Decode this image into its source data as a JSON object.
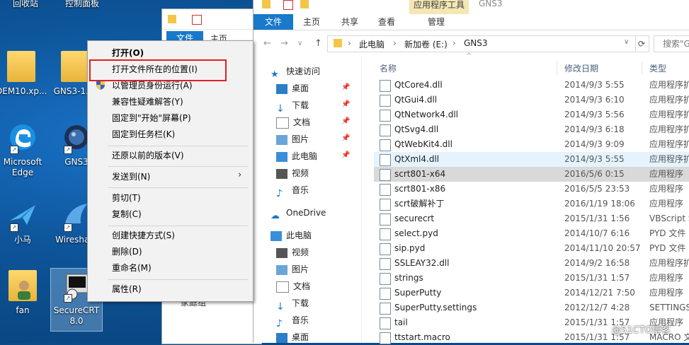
{
  "desktop": {
    "icons": [
      {
        "label": "回收站",
        "icon": "recycle-bin-icon"
      },
      {
        "label": "控制面板",
        "icon": "control-panel-icon"
      },
      {
        "label": "DEM10.xp...",
        "icon": "folder-icon"
      },
      {
        "label": "GNS3-1....",
        "icon": "folder-icon"
      },
      {
        "label": "Microsoft Edge",
        "icon": "edge-icon"
      },
      {
        "label": "GNS3",
        "icon": "gns3-icon"
      },
      {
        "label": "小马",
        "icon": "bird-icon"
      },
      {
        "label": "Wiresha...",
        "icon": "wireshark-icon"
      },
      {
        "label": "fan",
        "icon": "user-folder-icon"
      },
      {
        "label": "SecureCRT 8.0",
        "icon": "securecrt-icon"
      }
    ]
  },
  "back_window": {
    "file_tab": "文件",
    "home_tab": "主页",
    "nav_partial": "家庭组"
  },
  "window": {
    "context_tab_group": "应用程序工具",
    "title": "GNS3",
    "tabs": {
      "file": "文件",
      "home": "主页",
      "share": "共享",
      "view": "查看",
      "manage": "管理"
    },
    "address": {
      "crumbs": [
        "此电脑",
        "新加卷 (E:)",
        "GNS3"
      ]
    },
    "search_placeholder": "搜索\"G",
    "nav": [
      {
        "label": "快速访问",
        "icon": "star-icon",
        "pinned": false
      },
      {
        "label": "桌面",
        "icon": "desktop-icon",
        "pinned": true
      },
      {
        "label": "下载",
        "icon": "download-icon",
        "pinned": true
      },
      {
        "label": "文档",
        "icon": "document-icon",
        "pinned": true
      },
      {
        "label": "图片",
        "icon": "picture-icon",
        "pinned": true
      },
      {
        "label": "此电脑",
        "icon": "pc-icon",
        "pinned": true
      },
      {
        "label": "视频",
        "icon": "video-icon",
        "pinned": false
      },
      {
        "label": "音乐",
        "icon": "music-icon",
        "pinned": false
      },
      {
        "label": "OneDrive",
        "icon": "cloud-icon",
        "pinned": false
      },
      {
        "label": "此电脑",
        "icon": "pc-icon",
        "pinned": false
      },
      {
        "label": "视频",
        "icon": "video-icon",
        "pinned": false
      },
      {
        "label": "图片",
        "icon": "picture-icon",
        "pinned": false
      },
      {
        "label": "文档",
        "icon": "document-icon",
        "pinned": false
      },
      {
        "label": "下载",
        "icon": "download-icon",
        "pinned": false
      },
      {
        "label": "音乐",
        "icon": "music-icon",
        "pinned": false
      },
      {
        "label": "桌面",
        "icon": "desktop-icon",
        "pinned": false
      }
    ],
    "columns": {
      "name": "名称",
      "date": "修改日期",
      "type": "类型"
    },
    "files": [
      {
        "name": "QtCore4.dll",
        "date": "2014/9/3 5:55",
        "type": "应用程序扩"
      },
      {
        "name": "QtGui4.dll",
        "date": "2014/9/3 6:10",
        "type": "应用程序扩"
      },
      {
        "name": "QtNetwork4.dll",
        "date": "2014/9/3 5:56",
        "type": "应用程序扩"
      },
      {
        "name": "QtSvg4.dll",
        "date": "2014/9/3 6:18",
        "type": "应用程序扩"
      },
      {
        "name": "QtWebKit4.dll",
        "date": "2014/9/3 9:09",
        "type": "应用程序扩"
      },
      {
        "name": "QtXml4.dll",
        "date": "2014/9/3 5:55",
        "type": "应用程序扩"
      },
      {
        "name": "scrt801-x64",
        "date": "2016/5/6 0:15",
        "type": "应用程序"
      },
      {
        "name": "scrt801-x86",
        "date": "2016/5/5 23:53",
        "type": "应用程序"
      },
      {
        "name": "scrt破解补丁",
        "date": "2016/1/19 18:06",
        "type": "应用程序"
      },
      {
        "name": "securecrt",
        "date": "2015/1/31 1:56",
        "type": "VBScript S"
      },
      {
        "name": "select.pyd",
        "date": "2014/10/7 6:16",
        "type": "PYD 文件"
      },
      {
        "name": "sip.pyd",
        "date": "2014/11/10 20:57",
        "type": "PYD 文件"
      },
      {
        "name": "SSLEAY32.dll",
        "date": "2014/9/2 16:58",
        "type": "应用程序扩"
      },
      {
        "name": "strings",
        "date": "2015/1/31 1:57",
        "type": "应用程序"
      },
      {
        "name": "SuperPutty",
        "date": "2014/12/21 7:50",
        "type": "应用程序"
      },
      {
        "name": "SuperPutty.settings",
        "date": "2012/12/7 4:28",
        "type": "SETTINGS"
      },
      {
        "name": "tail",
        "date": "2015/1/31 1:57",
        "type": "应用程序"
      },
      {
        "name": "ttstart.macro",
        "date": "2015/1/31 1:57",
        "type": "MACRO 文"
      }
    ]
  },
  "context_menu": {
    "items": [
      "打开(O)",
      "打开文件所在的位置(I)",
      "以管理员身份运行(A)",
      "兼容性疑难解答(Y)",
      "固定到\"开始\"屏幕(P)",
      "固定到任务栏(K)",
      "还原以前的版本(V)",
      "发送到(N)",
      "剪切(T)",
      "复制(C)",
      "创建快捷方式(S)",
      "删除(D)",
      "重命名(M)",
      "属性(R)"
    ]
  },
  "watermark": "@51CTO博客",
  "colors": {
    "accent": "#1979ca",
    "highlight_border": "#e02020",
    "context_band": "#f4e7b3"
  }
}
